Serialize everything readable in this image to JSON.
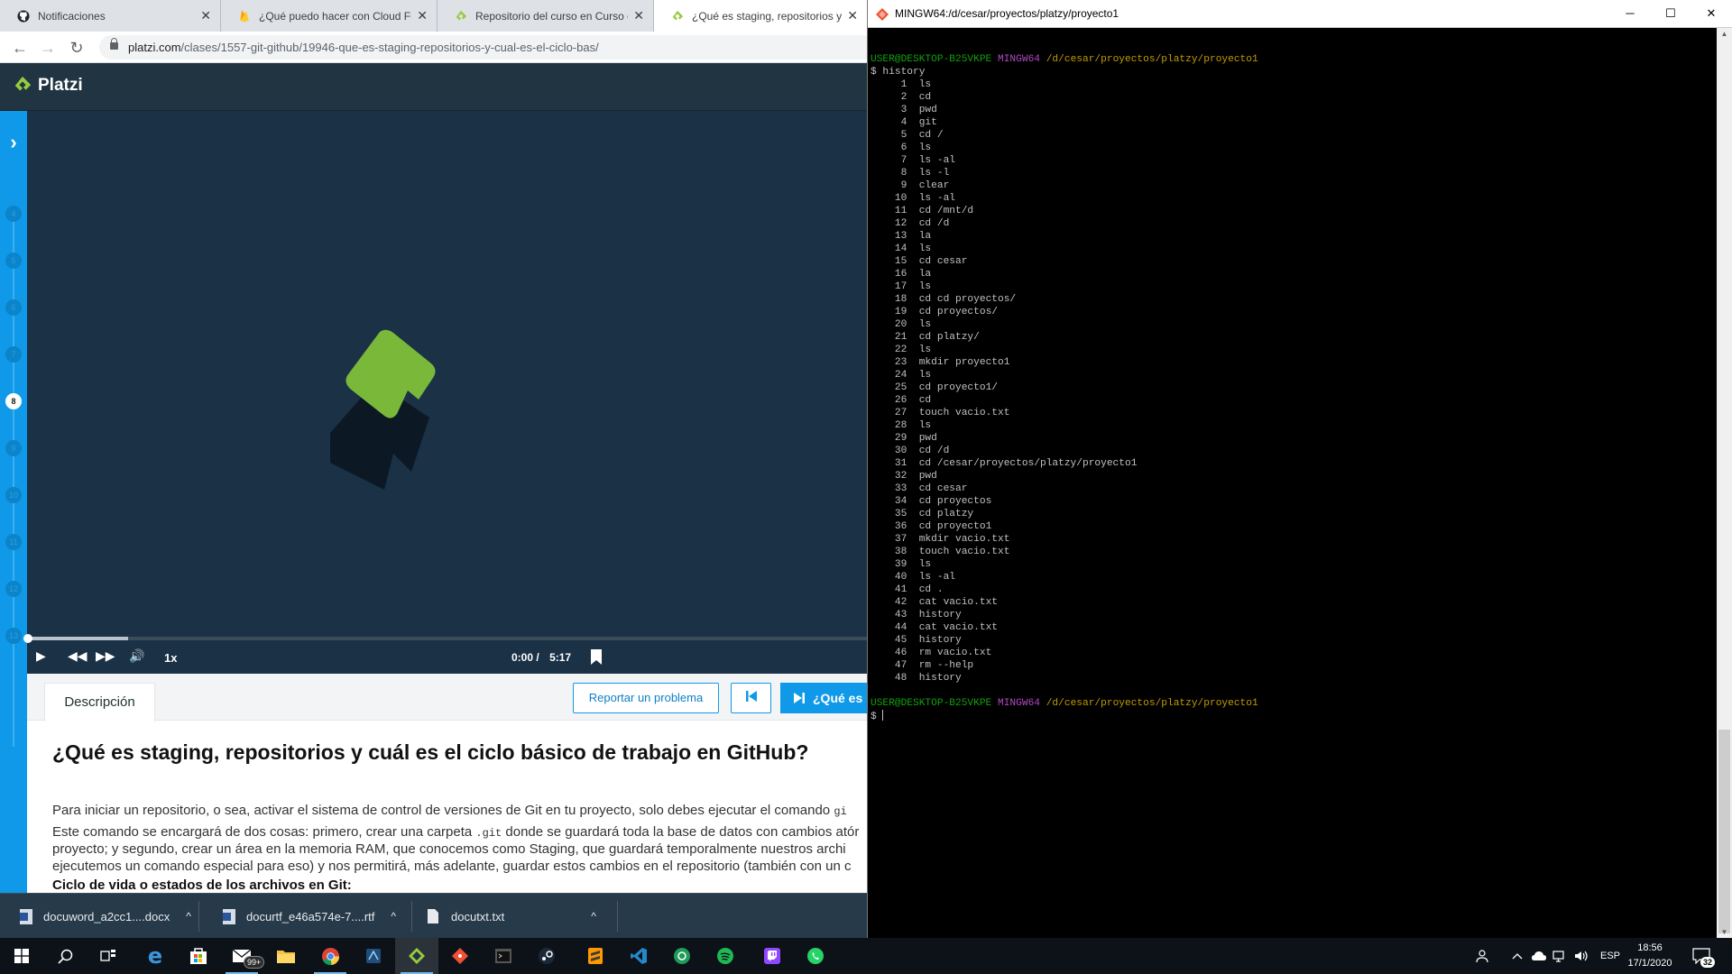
{
  "browser": {
    "tabs": [
      {
        "title": "Notificaciones",
        "close": "✕"
      },
      {
        "title": "¿Qué puedo hacer con Cloud Fu",
        "close": "✕"
      },
      {
        "title": "Repositorio del curso en Curso d",
        "close": "✕"
      },
      {
        "title": "¿Qué es staging, repositorios y c",
        "close": "✕"
      }
    ],
    "url_host": "platzi.com",
    "url_path": "/clases/1557-git-github/19946-que-es-staging-repositorios-y-cual-es-el-ciclo-bas/"
  },
  "platzi": {
    "logo_text": "Platzi",
    "sidebar_numbers": [
      "4",
      "5",
      "6",
      "7",
      "8",
      "9",
      "10",
      "11",
      "12",
      "13"
    ],
    "current_class": "8",
    "accent": "#0f99e8",
    "brand_green": "#98ca3f"
  },
  "player": {
    "speed": "1x",
    "current_time": "0:00",
    "time_separator": "/",
    "duration": "5:17",
    "progress_fraction": 0
  },
  "content": {
    "tab_description": "Descripción",
    "report_button": "Reportar un problema",
    "next_button": "¿Qué es u",
    "title": "¿Qué es staging, repositorios y cuál es el ciclo básico de trabajo en GitHub?",
    "p1": "Para iniciar un repositorio, o sea, activar el sistema de control de versiones de Git en tu proyecto, solo debes ejecutar el comando",
    "p1_code": "gi",
    "p2a_pre": "Este comando se encargará de dos cosas: primero, crear una carpeta",
    "p2a_code": ".git",
    "p2a_post": "donde se guardará toda la base de datos con cambios atór",
    "p2b": "proyecto; y segundo, crear un área en la memoria RAM, que conocemos como Staging, que guardará temporalmente nuestros archi",
    "p2c": "ejecutemos un comando especial para eso) y nos permitirá, más adelante, guardar estos cambios en el repositorio (también con un c",
    "subheading": "Ciclo de vida o estados de los archivos en Git:"
  },
  "downloads": [
    {
      "name": "docuword_a2cc1....docx",
      "caret": "^"
    },
    {
      "name": "docurtf_e46a574e-7....rtf",
      "caret": "^"
    },
    {
      "name": "docutxt.txt",
      "caret": "^"
    }
  ],
  "terminal": {
    "window_title": "MINGW64:/d/cesar/proyectos/platzy/proyecto1",
    "prompt_user": "USER@DESKTOP-B25VKPE",
    "prompt_env": "MINGW64",
    "prompt_path": "/d/cesar/proyectos/platzy/proyecto1",
    "first_command": "$ history",
    "history": [
      "ls",
      "cd",
      "pwd",
      "git",
      "cd /",
      "ls",
      "ls -al",
      "ls -l",
      "clear",
      "ls -al",
      "cd /mnt/d",
      "cd /d",
      "la",
      "ls",
      "cd cesar",
      "la",
      "ls",
      "cd cd proyectos/",
      "cd proyectos/",
      "ls",
      "cd platzy/",
      "ls",
      "mkdir proyecto1",
      "ls",
      "cd proyecto1/",
      "cd",
      "touch vacio.txt",
      "ls",
      "pwd",
      "cd /d",
      "cd /cesar/proyectos/platzy/proyecto1",
      "pwd",
      "cd cesar",
      "cd proyectos",
      "cd platzy",
      "cd proyecto1",
      "mkdir vacio.txt",
      "touch vacio.txt",
      "ls",
      "ls -al",
      "cd .",
      "cat vacio.txt",
      "history",
      "cat vacio.txt",
      "history",
      "rm vacio.txt",
      "rm --help",
      "history"
    ],
    "final_prompt": "$ "
  },
  "taskbar": {
    "mail_badge": "99+",
    "language": "ESP",
    "time": "18:56",
    "date": "17/1/2020",
    "notifications": "32"
  }
}
